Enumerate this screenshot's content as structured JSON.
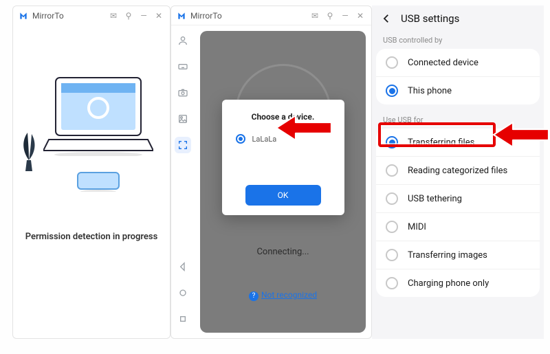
{
  "app": {
    "name": "MirrorTo"
  },
  "windowButtons": {
    "inbox": "✉",
    "pin": "⚲",
    "min": "—",
    "close": "✕"
  },
  "panel1": {
    "status": "Permission detection in progress"
  },
  "panel2": {
    "connecting": "Connecting...",
    "notRecognized": "Not recognized",
    "modal": {
      "title": "Choose a device.",
      "device": "LaLaLa",
      "ok": "OK"
    },
    "sidebarIcons": [
      "user",
      "keyboard",
      "camera",
      "photo",
      "expand",
      "back",
      "home",
      "recent"
    ]
  },
  "panel3": {
    "title": "USB settings",
    "group1": {
      "label": "USB controlled by",
      "options": [
        {
          "label": "Connected device",
          "selected": false
        },
        {
          "label": "This phone",
          "selected": true
        }
      ]
    },
    "group2": {
      "label": "Use USB for",
      "options": [
        {
          "label": "Transferring files",
          "selected": true,
          "highlight": true
        },
        {
          "label": "Reading categorized files",
          "selected": false
        },
        {
          "label": "USB tethering",
          "selected": false
        },
        {
          "label": "MIDI",
          "selected": false
        },
        {
          "label": "Transferring images",
          "selected": false
        },
        {
          "label": "Charging phone only",
          "selected": false
        }
      ]
    }
  },
  "colors": {
    "accent": "#1a73e8",
    "danger": "#e60000"
  }
}
